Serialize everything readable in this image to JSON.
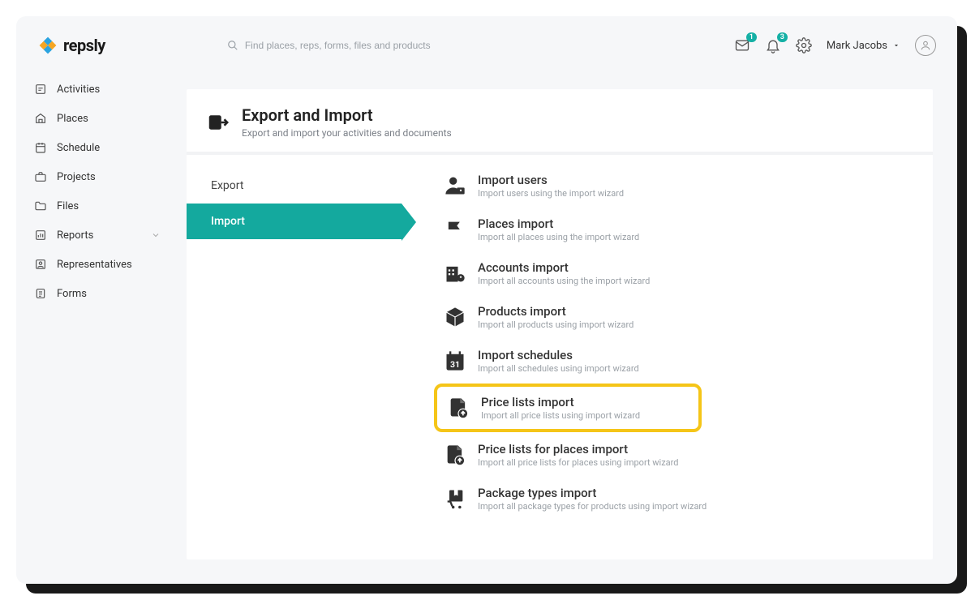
{
  "brand": {
    "name": "repsly"
  },
  "search": {
    "placeholder": "Find places, reps, forms, files and products"
  },
  "notifications": {
    "inbox_count": "1",
    "bell_count": "3"
  },
  "user": {
    "name": "Mark Jacobs"
  },
  "sidebar": {
    "items": [
      {
        "label": "Activities"
      },
      {
        "label": "Places"
      },
      {
        "label": "Schedule"
      },
      {
        "label": "Projects"
      },
      {
        "label": "Files"
      },
      {
        "label": "Reports"
      },
      {
        "label": "Representatives"
      },
      {
        "label": "Forms"
      }
    ]
  },
  "page": {
    "title": "Export and Import",
    "subtitle": "Export and import your activities and documents"
  },
  "tabs": {
    "export": "Export",
    "import": "Import"
  },
  "options": [
    {
      "title": "Import users",
      "sub": "Import users using the import wizard"
    },
    {
      "title": "Places import",
      "sub": "Import all places using the import wizard"
    },
    {
      "title": "Accounts import",
      "sub": "Import all accounts using the import wizard"
    },
    {
      "title": "Products import",
      "sub": "Import all products using import wizard"
    },
    {
      "title": "Import schedules",
      "sub": "Import all schedules using import wizard"
    },
    {
      "title": "Price lists import",
      "sub": "Import all price lists using import wizard"
    },
    {
      "title": "Price lists for places import",
      "sub": "Import all price lists for places using import wizard"
    },
    {
      "title": "Package types import",
      "sub": "Import all package types for products using import wizard"
    }
  ]
}
